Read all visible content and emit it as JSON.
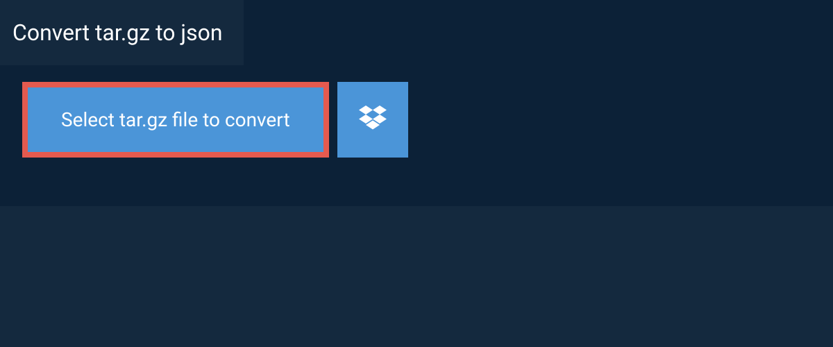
{
  "header": {
    "title": "Convert tar.gz to json"
  },
  "actions": {
    "select_label": "Select tar.gz file to convert"
  },
  "colors": {
    "bg_outer": "#14293e",
    "bg_panel": "#0c2137",
    "button_fill": "#4b95d8",
    "button_border": "#e55a4f"
  }
}
